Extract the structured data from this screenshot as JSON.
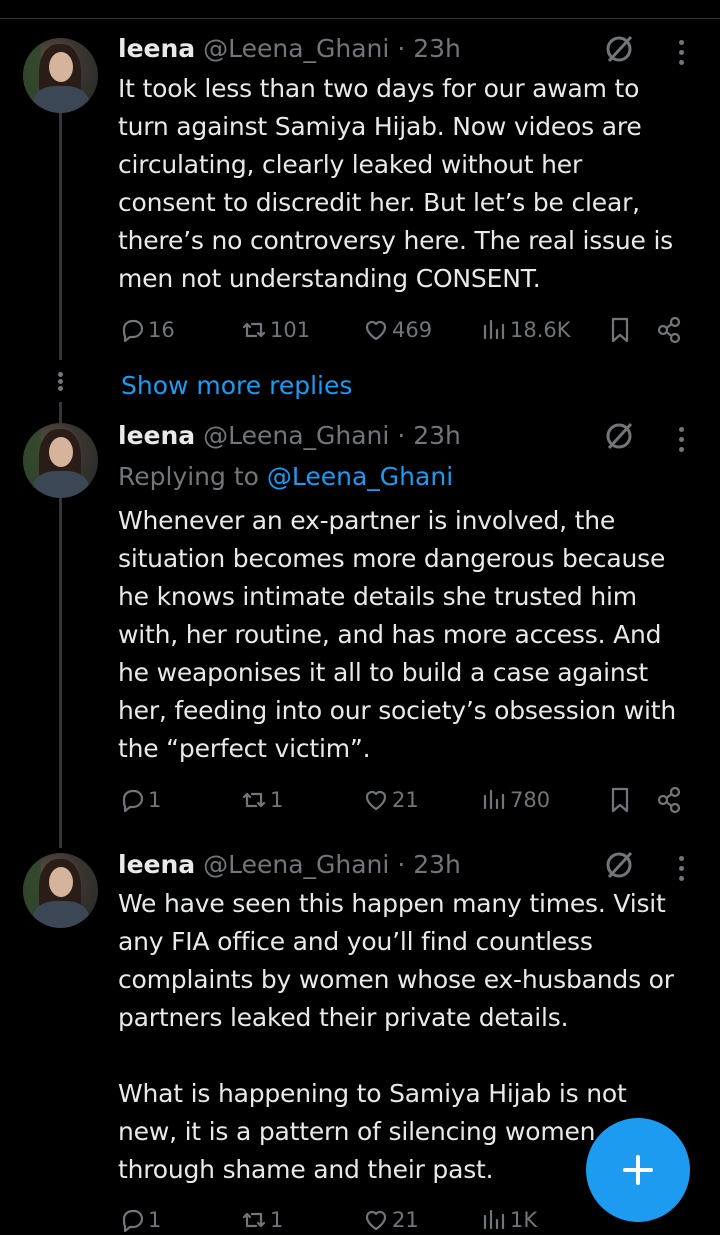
{
  "tweets": [
    {
      "name": "leena",
      "handle": "@Leena_Ghani",
      "time": "· 23h",
      "text": "It took less than two days for our awam to\nturn against Samiya Hijab. Now videos are\ncirculating, clearly leaked without her\nconsent to discredit her. But let’s be clear,\nthere’s no controversy here. The real issue is\nmen not understanding CONSENT.",
      "replies": "16",
      "reposts": "101",
      "likes": "469",
      "views": "18.6K"
    },
    {
      "name": "leena",
      "handle": "@Leena_Ghani",
      "time": "· 23h",
      "replying_prefix": "Replying to ",
      "replying_handle": "@Leena_Ghani",
      "text": "Whenever an ex-partner is involved, the\nsituation becomes more dangerous because\nhe knows intimate details she trusted him\nwith, her routine, and has more access. And\nhe weaponises it all to build a case against\nher, feeding into our society’s obsession with\nthe “perfect victim”.",
      "replies": "1",
      "reposts": "1",
      "likes": "21",
      "views": "780"
    },
    {
      "name": "leena",
      "handle": "@Leena_Ghani",
      "time": "· 23h",
      "text": "We have seen this happen many times. Visit\nany FIA office and you’ll find countless\ncomplaints by women whose ex-husbands or\npartners leaked their private details.\n\nWhat is happening to Samiya Hijab is not\nnew, it is a pattern of silencing women\nthrough shame and their past.",
      "replies": "1",
      "reposts": "1",
      "likes": "21",
      "views": "1K"
    }
  ],
  "show_more": "Show more replies",
  "colors": {
    "accent": "#1d9bf0",
    "muted": "#71767b",
    "text": "#e7e9ea",
    "bg": "#000000"
  },
  "icons": [
    "reply-icon",
    "repost-icon",
    "like-icon",
    "views-icon",
    "bookmark-icon",
    "share-icon",
    "grok-icon",
    "more-icon",
    "compose-plus-icon"
  ]
}
